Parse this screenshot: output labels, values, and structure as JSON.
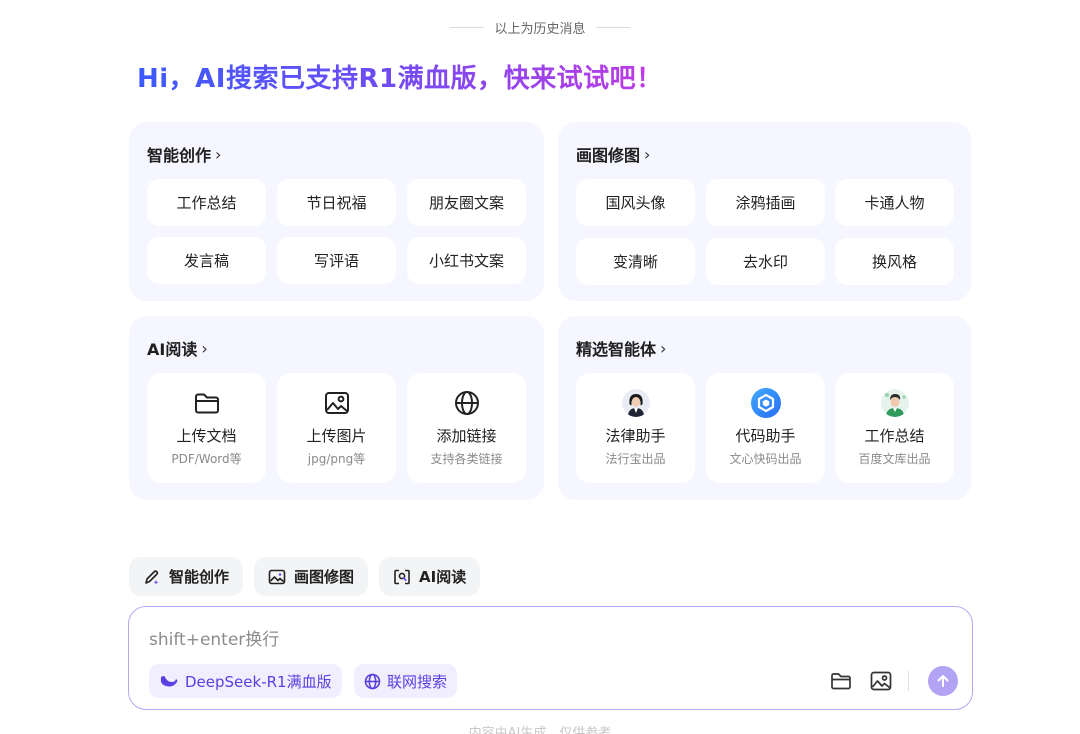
{
  "history_divider": "以上为历史消息",
  "hero_title": "Hi，AI搜索已支持R1满血版，快来试试吧！",
  "cards": {
    "writing": {
      "title": "智能创作",
      "chevron": "›",
      "items": [
        "工作总结",
        "节日祝福",
        "朋友圈文案",
        "发言稿",
        "写评语",
        "小红书文案"
      ]
    },
    "image": {
      "title": "画图修图",
      "chevron": "›",
      "items": [
        "国风头像",
        "涂鸦插画",
        "卡通人物",
        "变清晰",
        "去水印",
        "换风格"
      ]
    },
    "reading": {
      "title": "AI阅读",
      "chevron": "›",
      "items": [
        {
          "label": "上传文档",
          "sub": "PDF/Word等",
          "icon": "folder-icon"
        },
        {
          "label": "上传图片",
          "sub": "jpg/png等",
          "icon": "image-icon"
        },
        {
          "label": "添加链接",
          "sub": "支持各类链接",
          "icon": "globe-icon"
        }
      ]
    },
    "agents": {
      "title": "精选智能体",
      "chevron": "›",
      "items": [
        {
          "label": "法律助手",
          "sub": "法行宝出品",
          "icon": "lawyer-avatar"
        },
        {
          "label": "代码助手",
          "sub": "文心快码出品",
          "icon": "code-logo"
        },
        {
          "label": "工作总结",
          "sub": "百度文库出品",
          "icon": "worker-avatar"
        }
      ]
    }
  },
  "chips": [
    "智能创作",
    "画图修图",
    "AI阅读"
  ],
  "composer": {
    "placeholder": "shift+enter换行",
    "model_label": "DeepSeek-R1满血版",
    "web_search_label": "联网搜索"
  },
  "footer_note": "内容由AI生成，仅供参考",
  "colors": {
    "accent": "#5b3fe0",
    "card_bg": "#f5f6ff",
    "send": "#b3a3f5"
  }
}
